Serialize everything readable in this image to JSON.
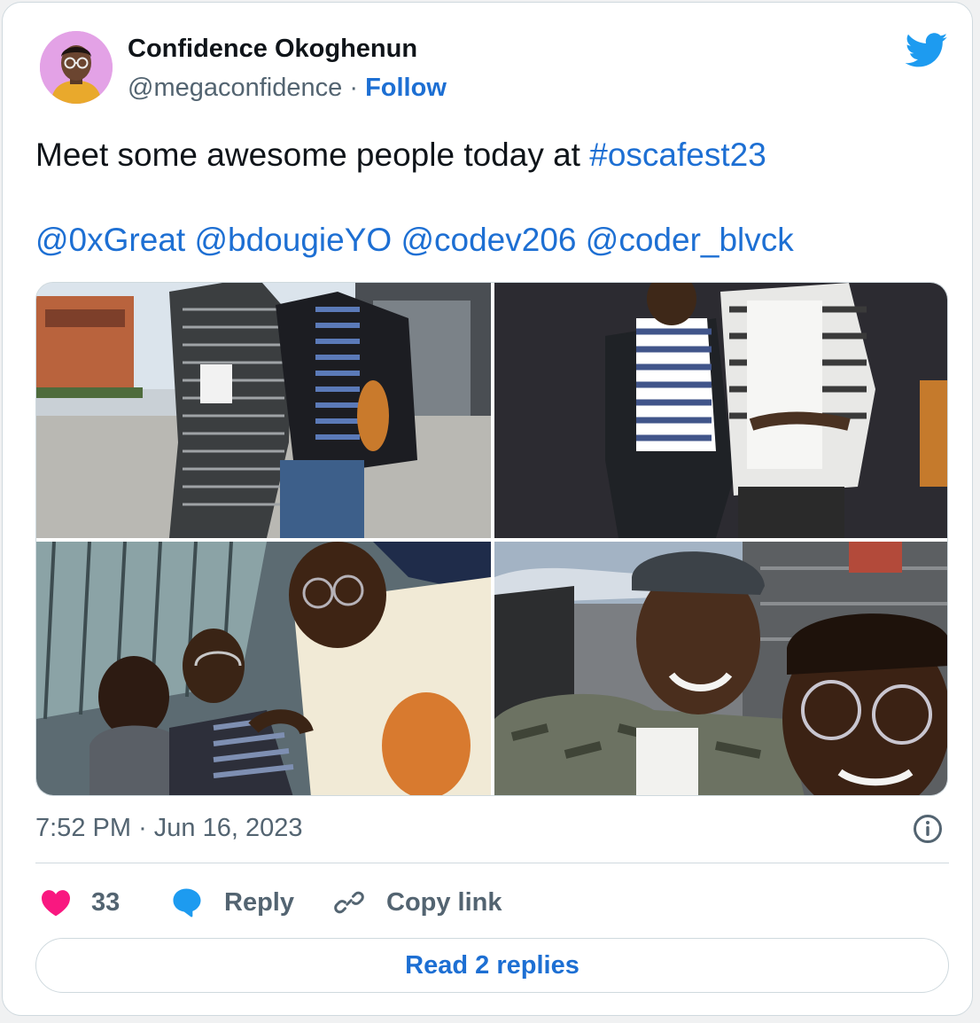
{
  "author": {
    "name": "Confidence Okoghenun",
    "handle": "@megaconfidence",
    "separator": "·",
    "follow_label": "Follow",
    "avatar_icon": "user-avatar-photo"
  },
  "brand": {
    "logo_icon": "twitter-bird-icon",
    "color": "#1d9bf0"
  },
  "tweet": {
    "text_prefix": "Meet some awesome people today at ",
    "hashtag": "#oscafest23",
    "mentions": [
      "@0xGreat",
      "@bdougieYO",
      "@codev206",
      "@coder_blvck"
    ]
  },
  "media": [
    {
      "alt": "Two men posing outside a conference venue"
    },
    {
      "alt": "Two men posing in front of a dark backdrop"
    },
    {
      "alt": "Group selfie at the conference entrance"
    },
    {
      "alt": "Two men taking a selfie outside"
    }
  ],
  "meta": {
    "time": "7:52 PM",
    "separator": "·",
    "date": "Jun 16, 2023",
    "info_icon": "info-icon"
  },
  "actions": {
    "like_count": "33",
    "like_icon": "heart-icon",
    "like_color": "#f91880",
    "reply_label": "Reply",
    "reply_icon": "speech-bubble-icon",
    "reply_color": "#1d9bf0",
    "copy_label": "Copy link",
    "copy_icon": "link-icon"
  },
  "read_replies_label": "Read 2 replies",
  "colors": {
    "link": "#1d6fd3",
    "secondary_text": "#536471",
    "border": "#cfd9de"
  }
}
